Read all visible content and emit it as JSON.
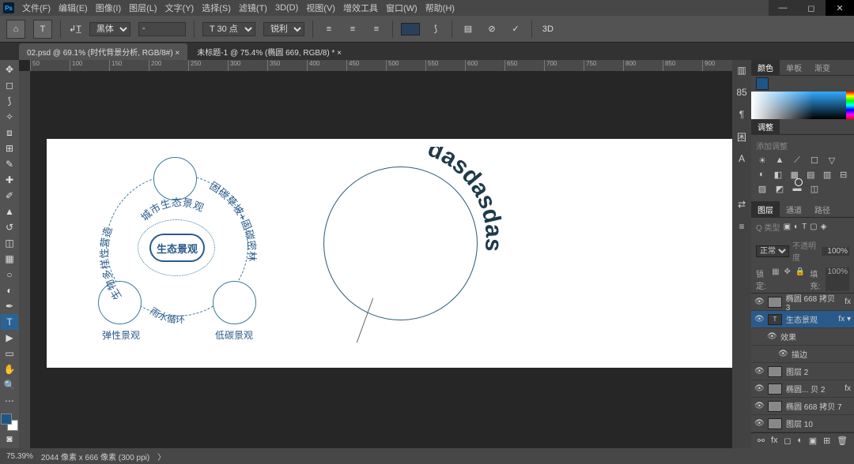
{
  "menu": [
    "文件(F)",
    "编辑(E)",
    "图像(I)",
    "图层(L)",
    "文字(Y)",
    "选择(S)",
    "滤镜(T)",
    "3D(D)",
    "视图(V)",
    "增效工具",
    "窗口(W)",
    "帮助(H)"
  ],
  "opt": {
    "font": "黑体",
    "size": "T 30 点",
    "aa": "锐利"
  },
  "tabs": [
    {
      "t": "02.psd @ 69.1% (时代背景分析, RGB/8#) ×"
    },
    {
      "t": "未标题-1 @ 75.4% (椭圆 669, RGB/8) * ×"
    }
  ],
  "ruler": [
    "50",
    "100",
    "150",
    "200",
    "250",
    "300",
    "350",
    "400",
    "450",
    "500",
    "550",
    "600",
    "650",
    "700",
    "750",
    "800",
    "850",
    "900"
  ],
  "d1": {
    "center": "生态景观",
    "sub": "城市生态景观",
    "left": "生物多样性营造",
    "right": "固碳草坡+固碳密林",
    "b1": "弹性景观",
    "b2": "雨水循环",
    "b3": "低碳景观"
  },
  "d2text": "dasdasdas",
  "panel_tabs": {
    "color": "颜色",
    "swatch": "单板",
    "grad": "渐变"
  },
  "adj_title": "调整",
  "adj_sub": "添加调整",
  "lay_tabs": {
    "l": "图层",
    "c": "通道",
    "p": "路径"
  },
  "blend": "正常",
  "opacity": "100%",
  "fill": "100%",
  "lock": "锁定:",
  "fill_lbl": "填充:",
  "search_ph": "Q 类型",
  "layers": [
    {
      "n": "椭圆 668 拷贝 3",
      "t": "shape"
    },
    {
      "n": "生态景观",
      "t": "text",
      "sel": true
    },
    {
      "n": "效果",
      "indent": 1,
      "fx": true
    },
    {
      "n": "描边",
      "indent": 2,
      "fx": true
    },
    {
      "n": "图层 2",
      "t": "layer"
    },
    {
      "n": "椭圆... 贝 2",
      "t": "shape"
    },
    {
      "n": "椭圆 668 拷贝 7",
      "t": "shape"
    },
    {
      "n": "图层 10",
      "t": "layer"
    }
  ],
  "status": {
    "zoom": "75.39%",
    "dim": "2044 像素 x 666 像素 (300 ppi)"
  }
}
